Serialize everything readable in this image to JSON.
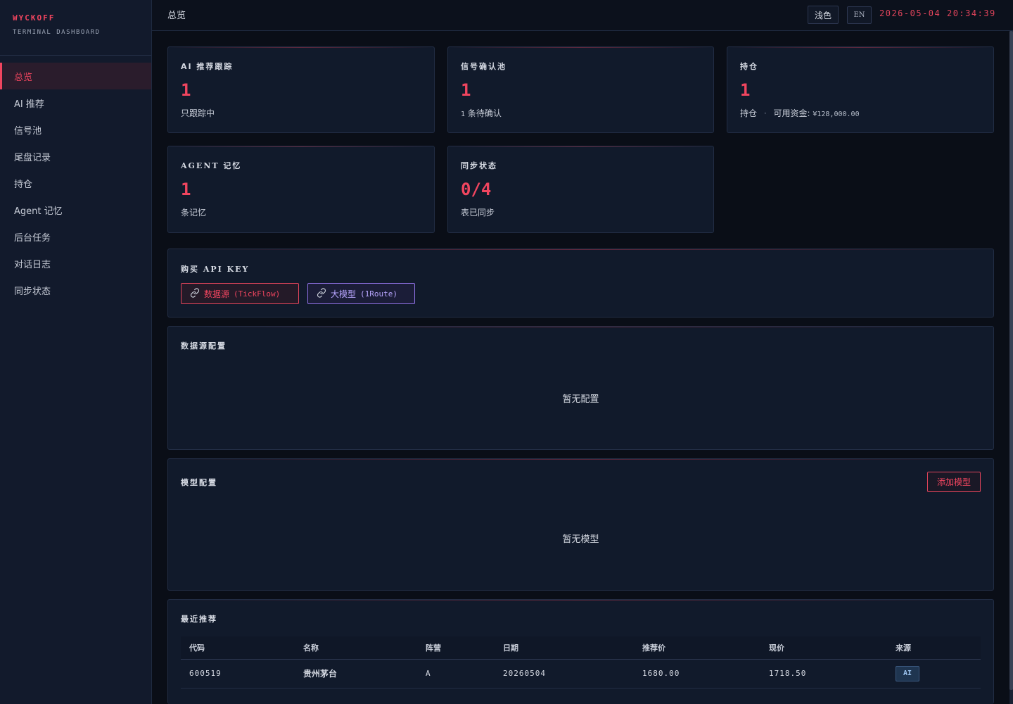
{
  "brand": {
    "title": "WYCKOFF",
    "subtitle": "TERMINAL DASHBOARD"
  },
  "nav": {
    "items": [
      {
        "label": "总览",
        "active": true
      },
      {
        "label": "AI 推荐",
        "active": false
      },
      {
        "label": "信号池",
        "active": false
      },
      {
        "label": "尾盘记录",
        "active": false
      },
      {
        "label": "持仓",
        "active": false
      },
      {
        "label": "Agent 记忆",
        "active": false
      },
      {
        "label": "后台任务",
        "active": false
      },
      {
        "label": "对话日志",
        "active": false
      },
      {
        "label": "同步状态",
        "active": false
      }
    ]
  },
  "header": {
    "title": "总览",
    "theme_button": "浅色",
    "lang_button": "EN",
    "clock": "2026-05-04 20:34:39"
  },
  "stats": {
    "ai_tracking": {
      "label": "AI 推荐跟踪",
      "value": "1",
      "sub": "只跟踪中"
    },
    "signal_pool": {
      "label": "信号确认池",
      "value": "1",
      "sub_count": "1",
      "sub_text": "条待确认"
    },
    "positions": {
      "label": "持仓",
      "value": "1",
      "sub_text": "持仓",
      "sep": "·",
      "cash_label": "可用资金:",
      "cash_value": "¥128,000.00"
    },
    "agent_memory": {
      "label": "AGENT 记忆",
      "value": "1",
      "sub": "条记忆"
    },
    "sync_status": {
      "label": "同步状态",
      "value": "0/4",
      "sub": "表已同步"
    }
  },
  "api_keys": {
    "label": "购买 API KEY",
    "datasource": {
      "label": "数据源",
      "suffix": "(TickFlow)"
    },
    "llm": {
      "label": "大模型",
      "suffix": "(1Route)"
    }
  },
  "datasource_config": {
    "label": "数据源配置",
    "empty": "暂无配置"
  },
  "model_config": {
    "label": "模型配置",
    "add_button": "添加模型",
    "empty": "暂无模型"
  },
  "recent": {
    "label": "最近推荐",
    "columns": [
      "代码",
      "名称",
      "阵营",
      "日期",
      "推荐价",
      "现价",
      "来源"
    ],
    "rows": [
      {
        "code": "600519",
        "name": "贵州茅台",
        "camp": "A",
        "date": "20260504",
        "rec_price": "1680.00",
        "cur_price": "1718.50",
        "source": "AI"
      }
    ]
  },
  "colors": {
    "accent": "#f0455f",
    "purple": "#8c6fe0",
    "bg": "#0a0e17",
    "card": "#111a2b"
  }
}
